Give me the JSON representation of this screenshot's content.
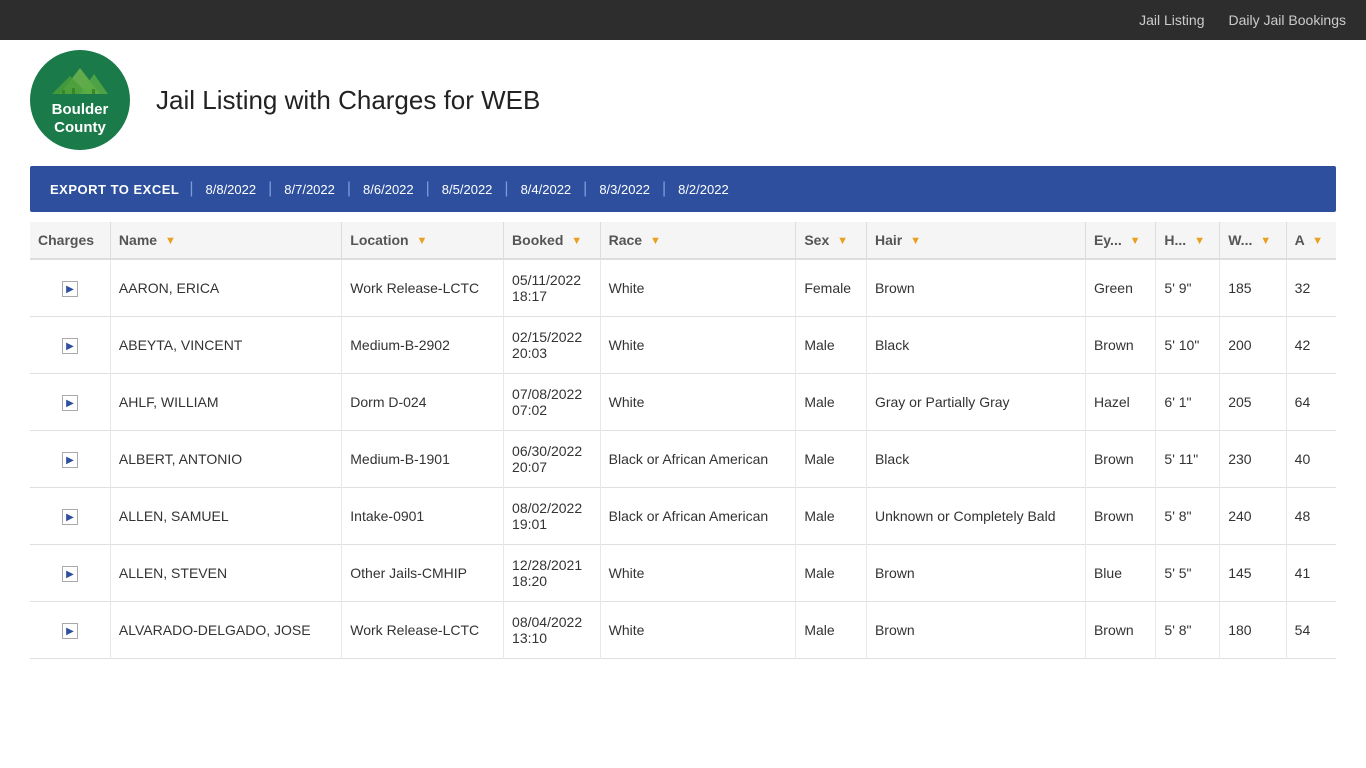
{
  "nav": {
    "jail_listing": "Jail Listing",
    "daily_bookings": "Daily Jail Bookings"
  },
  "logo": {
    "line1": "Boulder",
    "line2": "County"
  },
  "page_title": "Jail Listing with Charges for WEB",
  "export_bar": {
    "export_label": "EXPORT TO EXCEL",
    "dates": [
      "8/8/2022",
      "8/7/2022",
      "8/6/2022",
      "8/5/2022",
      "8/4/2022",
      "8/3/2022",
      "8/2/2022"
    ]
  },
  "table": {
    "columns": [
      "Charges",
      "Name",
      "Location",
      "Booked",
      "Race",
      "Sex",
      "Hair",
      "Ey...",
      "H...",
      "W...",
      "A"
    ],
    "rows": [
      {
        "charges": "▶",
        "name": "AARON, ERICA",
        "location": "Work Release-LCTC",
        "booked": "05/11/2022\n18:17",
        "race": "White",
        "sex": "Female",
        "hair": "Brown",
        "eyes": "Green",
        "height": "5' 9\"",
        "weight": "185",
        "age": "32"
      },
      {
        "charges": "▶",
        "name": "ABEYTA, VINCENT",
        "location": "Medium-B-2902",
        "booked": "02/15/2022\n20:03",
        "race": "White",
        "sex": "Male",
        "hair": "Black",
        "eyes": "Brown",
        "height": "5' 10\"",
        "weight": "200",
        "age": "42"
      },
      {
        "charges": "▶",
        "name": "AHLF, WILLIAM",
        "location": "Dorm D-024",
        "booked": "07/08/2022\n07:02",
        "race": "White",
        "sex": "Male",
        "hair": "Gray or Partially Gray",
        "eyes": "Hazel",
        "height": "6' 1\"",
        "weight": "205",
        "age": "64"
      },
      {
        "charges": "▶",
        "name": "ALBERT, ANTONIO",
        "location": "Medium-B-1901",
        "booked": "06/30/2022\n20:07",
        "race": "Black or African American",
        "sex": "Male",
        "hair": "Black",
        "eyes": "Brown",
        "height": "5' 11\"",
        "weight": "230",
        "age": "40"
      },
      {
        "charges": "▶",
        "name": "ALLEN, SAMUEL",
        "location": "Intake-0901",
        "booked": "08/02/2022\n19:01",
        "race": "Black or African American",
        "sex": "Male",
        "hair": "Unknown or Completely Bald",
        "eyes": "Brown",
        "height": "5' 8\"",
        "weight": "240",
        "age": "48"
      },
      {
        "charges": "▶",
        "name": "ALLEN, STEVEN",
        "location": "Other Jails-CMHIP",
        "booked": "12/28/2021\n18:20",
        "race": "White",
        "sex": "Male",
        "hair": "Brown",
        "eyes": "Blue",
        "height": "5' 5\"",
        "weight": "145",
        "age": "41"
      },
      {
        "charges": "▶",
        "name": "ALVARADO-DELGADO, JOSE",
        "location": "Work Release-LCTC",
        "booked": "08/04/2022\n13:10",
        "race": "White",
        "sex": "Male",
        "hair": "Brown",
        "eyes": "Brown",
        "height": "5' 8\"",
        "weight": "180",
        "age": "54"
      }
    ]
  }
}
